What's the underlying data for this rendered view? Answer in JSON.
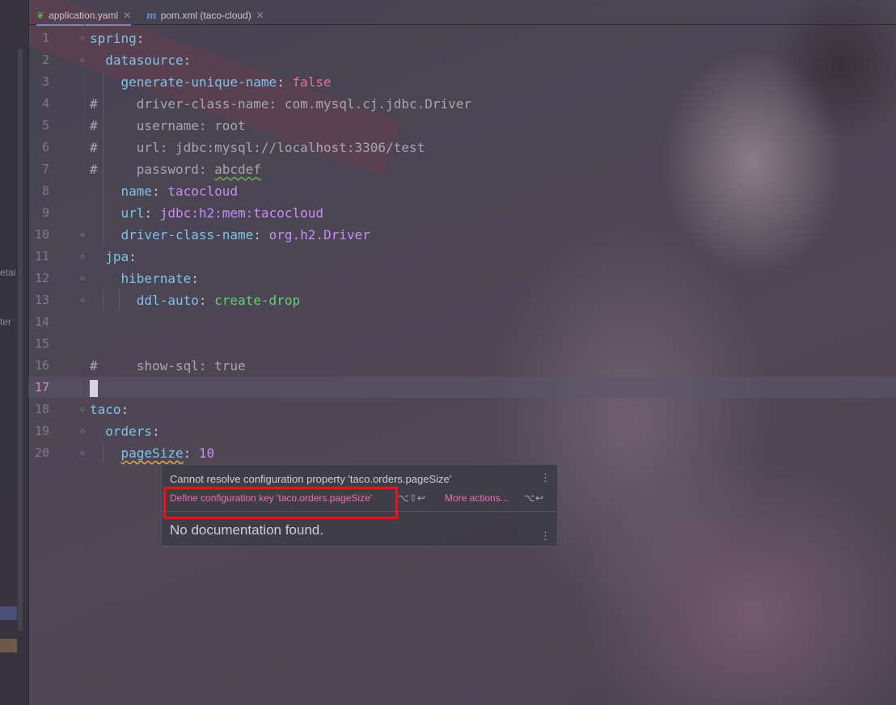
{
  "tabs": [
    {
      "label": "application.yaml",
      "icon": "spring-leaf-icon",
      "active": true
    },
    {
      "label": "pom.xml (taco-cloud)",
      "icon": "maven-m-icon",
      "active": false
    }
  ],
  "left_panel_stubs": [
    "etai",
    "ter"
  ],
  "editor": {
    "current_line": 17,
    "lines": [
      {
        "n": "1",
        "tokens": [
          {
            "t": "spring",
            "c": "k"
          },
          {
            "t": ":",
            "c": ""
          }
        ]
      },
      {
        "n": "2",
        "tokens": [
          {
            "t": "  ",
            "c": ""
          },
          {
            "t": "datasource",
            "c": "k"
          },
          {
            "t": ":",
            "c": ""
          }
        ]
      },
      {
        "n": "3",
        "tokens": [
          {
            "t": "    ",
            "c": ""
          },
          {
            "t": "generate-unique-name",
            "c": "k"
          },
          {
            "t": ": ",
            "c": ""
          },
          {
            "t": "false",
            "c": "b"
          }
        ]
      },
      {
        "n": "4",
        "tokens": [
          {
            "t": "#     driver-class-name: com.mysql.cj.jdbc.Driver",
            "c": "c"
          }
        ]
      },
      {
        "n": "5",
        "tokens": [
          {
            "t": "#     username: root",
            "c": "c"
          }
        ]
      },
      {
        "n": "6",
        "tokens": [
          {
            "t": "#     url: jdbc:mysql://localhost:3306/test",
            "c": "c"
          }
        ]
      },
      {
        "n": "7",
        "tokens": [
          {
            "t": "#     password: ",
            "c": "c"
          },
          {
            "t": "abcdef",
            "c": "c wavy-g"
          }
        ]
      },
      {
        "n": "8",
        "tokens": [
          {
            "t": "    ",
            "c": ""
          },
          {
            "t": "name",
            "c": "k"
          },
          {
            "t": ": ",
            "c": ""
          },
          {
            "t": "tacocloud",
            "c": "v"
          }
        ]
      },
      {
        "n": "9",
        "tokens": [
          {
            "t": "    ",
            "c": ""
          },
          {
            "t": "url",
            "c": "k"
          },
          {
            "t": ": ",
            "c": ""
          },
          {
            "t": "jdbc:h2:mem:tacocloud",
            "c": "v"
          }
        ]
      },
      {
        "n": "10",
        "tokens": [
          {
            "t": "    ",
            "c": ""
          },
          {
            "t": "driver-class-name",
            "c": "k"
          },
          {
            "t": ": ",
            "c": ""
          },
          {
            "t": "org.h2.Driver",
            "c": "v"
          }
        ]
      },
      {
        "n": "11",
        "tokens": [
          {
            "t": "  ",
            "c": ""
          },
          {
            "t": "jpa",
            "c": "k"
          },
          {
            "t": ":",
            "c": ""
          }
        ]
      },
      {
        "n": "12",
        "tokens": [
          {
            "t": "    ",
            "c": ""
          },
          {
            "t": "hibernate",
            "c": "k"
          },
          {
            "t": ":",
            "c": ""
          }
        ]
      },
      {
        "n": "13",
        "tokens": [
          {
            "t": "      ",
            "c": ""
          },
          {
            "t": "ddl-auto",
            "c": "k"
          },
          {
            "t": ": ",
            "c": ""
          },
          {
            "t": "create-drop",
            "c": "g"
          }
        ]
      },
      {
        "n": "14",
        "tokens": []
      },
      {
        "n": "15",
        "tokens": []
      },
      {
        "n": "16",
        "tokens": [
          {
            "t": "#     show-sql: true",
            "c": "c"
          }
        ]
      },
      {
        "n": "17",
        "tokens": []
      },
      {
        "n": "18",
        "tokens": [
          {
            "t": "taco",
            "c": "k"
          },
          {
            "t": ":",
            "c": ""
          }
        ]
      },
      {
        "n": "19",
        "tokens": [
          {
            "t": "  ",
            "c": ""
          },
          {
            "t": "orders",
            "c": "k"
          },
          {
            "t": ":",
            "c": ""
          }
        ]
      },
      {
        "n": "20",
        "tokens": [
          {
            "t": "    ",
            "c": ""
          },
          {
            "t": "pageSize",
            "c": "k wavy"
          },
          {
            "t": ": ",
            "c": ""
          },
          {
            "t": "10",
            "c": "n"
          }
        ]
      }
    ]
  },
  "popup": {
    "message": "Cannot resolve configuration property 'taco.orders.pageSize'",
    "fix_label": "Define configuration key 'taco.orders.pageSize'",
    "fix_shortcut": "⌥⇧↩",
    "more_label": "More actions...",
    "more_shortcut": "⌥↩",
    "doc_text": "No documentation found.",
    "menu_icon": "kebab-menu-icon"
  },
  "colors": {
    "key": "#7ec3e6",
    "string_value": "#c68ef0",
    "boolean": "#e8719f",
    "enum_value": "#60d26e",
    "link_action": "#ef6fb0",
    "highlight_box": "#e31616"
  }
}
